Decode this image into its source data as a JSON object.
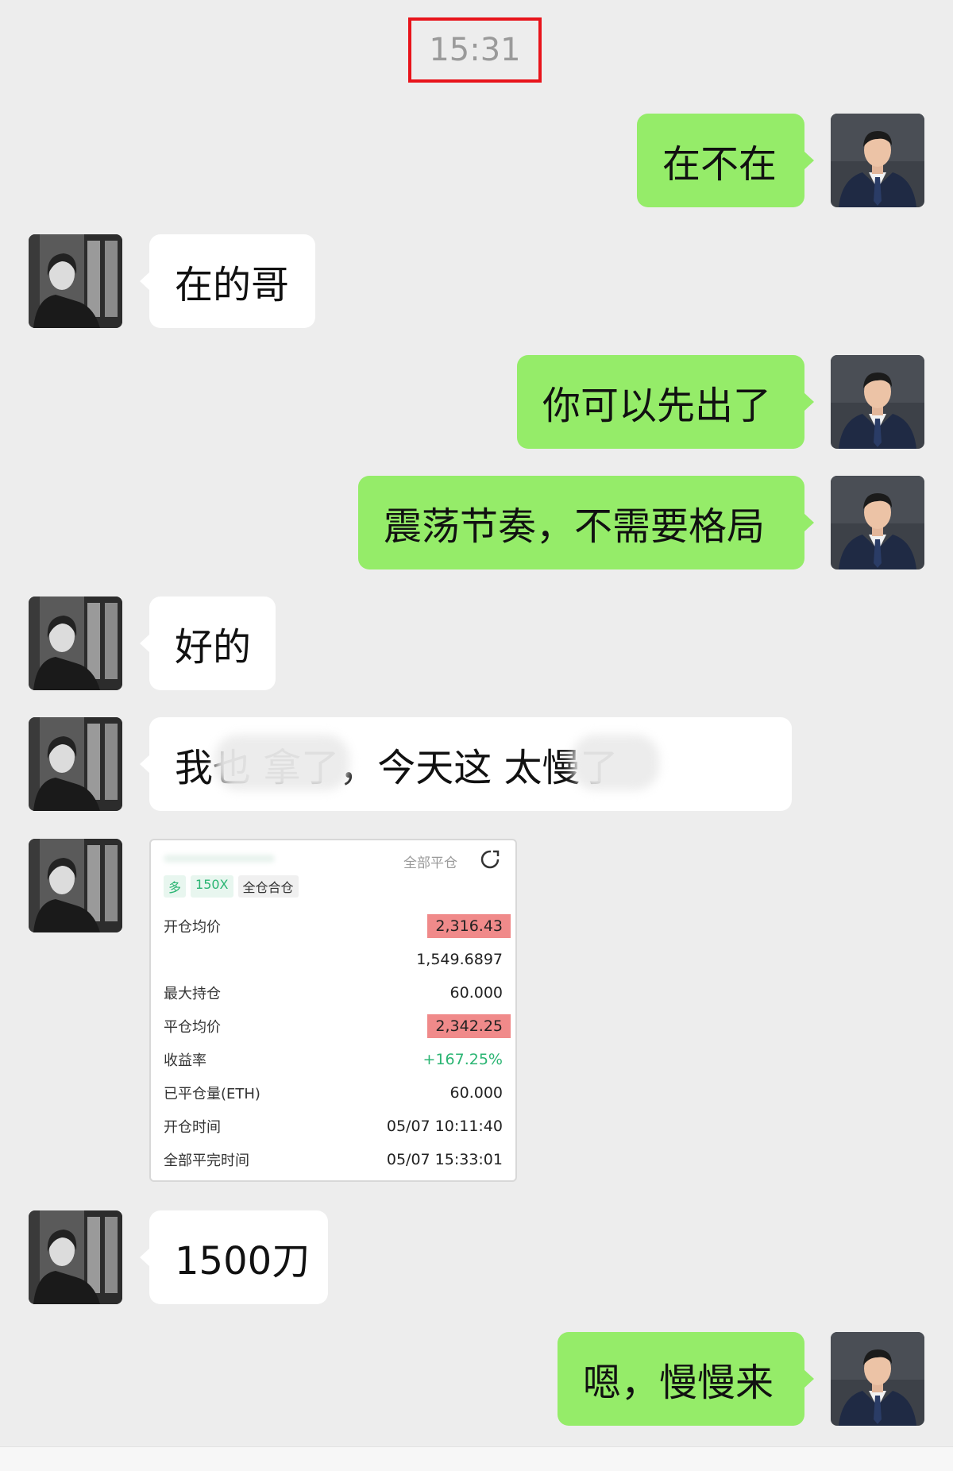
{
  "timestamp": "15:31",
  "messages": [
    {
      "side": "out",
      "text": "在不在"
    },
    {
      "side": "in",
      "text": "在的哥"
    },
    {
      "side": "out",
      "text": "你可以先出了"
    },
    {
      "side": "out",
      "text": "震荡节奏，不需要格局"
    },
    {
      "side": "in",
      "text": "好的"
    },
    {
      "side": "in",
      "text": "我也    拿了，今天这    太慢了"
    },
    {
      "side": "in",
      "text": "1500刀"
    },
    {
      "side": "out",
      "text": "嗯，慢慢来"
    }
  ],
  "trade_card": {
    "close_all_label": "全部平仓",
    "tags": [
      "多",
      "150X",
      "全仓合仓"
    ],
    "rows": [
      {
        "label": "开仓均价",
        "value": "2,316.43"
      },
      {
        "label": "",
        "value": "1,549.6897"
      },
      {
        "label": "最大持仓",
        "value": "60.000"
      },
      {
        "label": "平仓均价",
        "value": "2,342.25"
      },
      {
        "label": "收益率",
        "value": "+167.25%"
      },
      {
        "label": "已平仓量(ETH)",
        "value": "60.000"
      },
      {
        "label": "开仓时间",
        "value": "05/07 10:11:40"
      },
      {
        "label": "全部平完时间",
        "value": "05/07 15:33:01"
      }
    ]
  },
  "colors": {
    "background": "#ededed",
    "outgoing_bubble": "#95ec69",
    "incoming_bubble": "#ffffff",
    "highlight_box": "#e8141b",
    "profit_green": "#2bb573"
  }
}
